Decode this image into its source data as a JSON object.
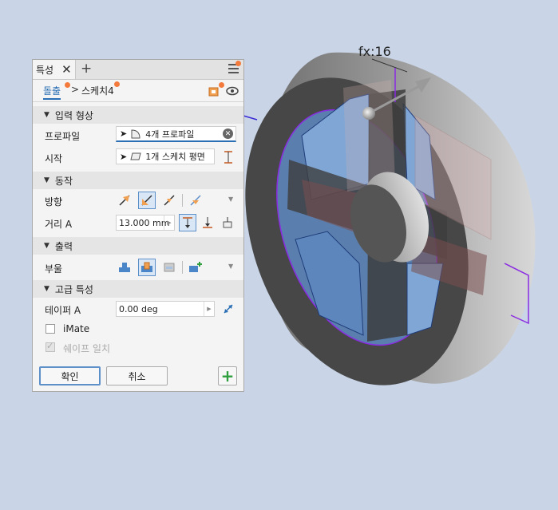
{
  "viewport": {
    "dimension_label": "fx:16",
    "colors": {
      "background": "#c9d5e6",
      "rim": "#8a8a8a",
      "inner": "#6d94c4",
      "edge": "#8a2be2"
    }
  },
  "panel": {
    "tab_label": "특성",
    "close_glyph": "✕",
    "add_glyph": "+",
    "breadcrumb": {
      "feature": "돌출",
      "separator": ">",
      "sketch": "스케치4"
    },
    "sections": {
      "input": "입력 형상",
      "behavior": "동작",
      "output": "출력",
      "advanced": "고급 특성"
    },
    "input": {
      "profile_label": "프로파일",
      "profile_value": "4개 프로파일",
      "start_label": "시작",
      "start_value": "1개 스케치 평면"
    },
    "behavior": {
      "direction_label": "방향",
      "distance_label": "거리 A",
      "distance_value": "13.000 mm"
    },
    "output": {
      "boolean_label": "부울"
    },
    "advanced": {
      "taper_label": "테이퍼 A",
      "taper_value": "0.00 deg",
      "imate_label": "iMate",
      "shape_match_label": "쉐이프 일치"
    },
    "buttons": {
      "ok": "확인",
      "cancel": "취소",
      "add": "+"
    },
    "accent_color": "#2a6fb5",
    "badge_color": "#f47a3c"
  }
}
